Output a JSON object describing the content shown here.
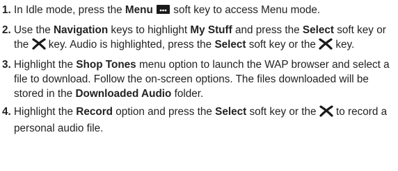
{
  "steps": [
    {
      "num": "1.",
      "parts": [
        {
          "t": "In Idle mode, press the "
        },
        {
          "t": "Menu",
          "b": true
        },
        {
          "t": " "
        },
        {
          "icon": "menu-softkey-icon"
        },
        {
          "t": " soft key to access Menu mode."
        }
      ]
    },
    {
      "num": "2.",
      "parts": [
        {
          "t": "Use the "
        },
        {
          "t": "Navigation",
          "b": true
        },
        {
          "t": " keys to highlight "
        },
        {
          "t": "My Stuff",
          "b": true
        },
        {
          "t": " and press the "
        },
        {
          "t": "Select",
          "b": true
        },
        {
          "t": " soft key or the "
        },
        {
          "icon": "select-key-icon"
        },
        {
          "t": " key. Audio is highlighted, press the "
        },
        {
          "t": "Select",
          "b": true
        },
        {
          "t": " soft key or the "
        },
        {
          "icon": "select-key-icon"
        },
        {
          "t": " key."
        }
      ]
    },
    {
      "num": "3.",
      "parts": [
        {
          "t": "Highlight the "
        },
        {
          "t": "Shop Tones",
          "b": true
        },
        {
          "t": " menu option to launch the WAP browser and select a file to download. Follow the on-screen options. The files downloaded will be stored in the "
        },
        {
          "t": "Downloaded Audio",
          "b": true
        },
        {
          "t": " folder."
        }
      ]
    },
    {
      "num": "4.",
      "parts": [
        {
          "t": "Highlight the "
        },
        {
          "t": "Record",
          "b": true
        },
        {
          "t": " option and press the "
        },
        {
          "t": "Select",
          "b": true
        },
        {
          "t": " soft key or the "
        },
        {
          "icon": "select-key-icon"
        },
        {
          "t": " to record a personal audio file."
        }
      ]
    }
  ],
  "colors": {
    "text": "#222222",
    "icon": "#1a1a1a"
  }
}
